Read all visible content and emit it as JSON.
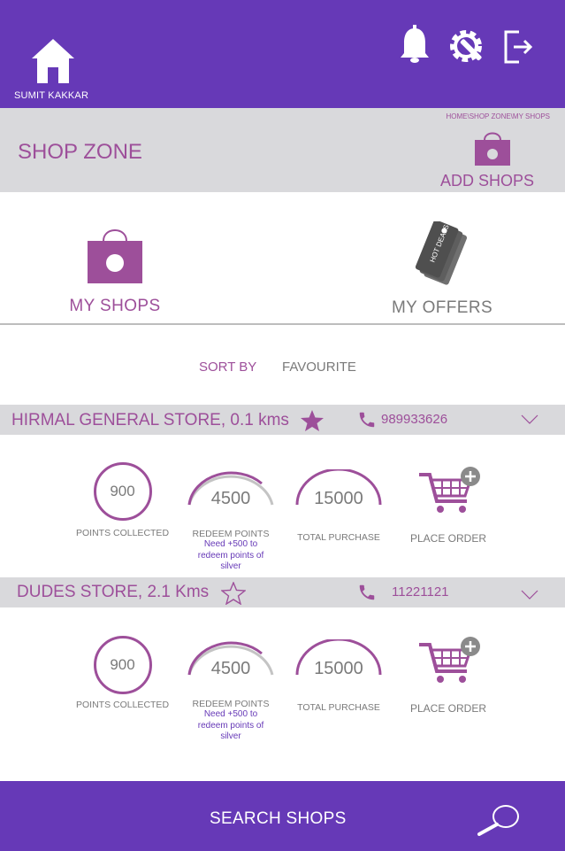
{
  "header": {
    "user_name": "SUMIT KAKKAR",
    "icons": [
      "home-icon",
      "bell-icon",
      "settings-icon",
      "logout-icon"
    ]
  },
  "zone": {
    "breadcrumb": "HOME\\SHOP ZONE\\MY SHOPS",
    "title": "SHOP ZONE",
    "add_label": "ADD SHOPS"
  },
  "tiles": {
    "my_shops": "MY SHOPS",
    "my_offers": "MY OFFERS",
    "hot_deals_tag": "HOT DEALS"
  },
  "sort": {
    "label": "SORT BY",
    "value": "FAVOURITE"
  },
  "stores": [
    {
      "name": "HIRMAL GENERAL STORE, 0.1 kms",
      "phone": "989933626",
      "favourite": true,
      "points_collected": "900",
      "points_collected_label": "POINTS COLLECTED",
      "redeem_points": "4500",
      "redeem_label": "REDEEM POINTS",
      "redeem_note": "Need +500 to redeem points of silver",
      "total_purchase": "15000",
      "total_purchase_label": "TOTAL PURCHASE",
      "order_label": "PLACE ORDER"
    },
    {
      "name": "DUDES STORE, 2.1 Kms",
      "phone": "11221121",
      "favourite": false,
      "points_collected": "900",
      "points_collected_label": "POINTS COLLECTED",
      "redeem_points": "4500",
      "redeem_label": "REDEEM POINTS",
      "redeem_note": "Need +500 to redeem points of silver",
      "total_purchase": "15000",
      "total_purchase_label": "TOTAL PURCHASE",
      "order_label": "PLACE ORDER"
    }
  ],
  "footer": {
    "search_label": "SEARCH SHOPS"
  },
  "colors": {
    "header": "#6639b7",
    "accent": "#9d4f9a",
    "bar": "#d9d9dc",
    "text_gray": "#7a7a7a"
  }
}
